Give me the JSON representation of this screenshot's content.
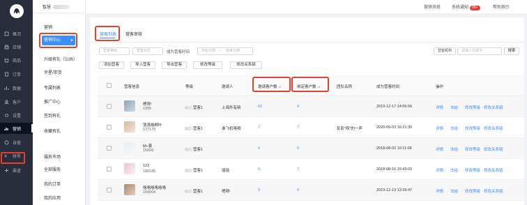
{
  "sidebar": {
    "items": [
      {
        "label": "概况",
        "icon": "home-icon"
      },
      {
        "label": "店铺",
        "icon": "shop-icon"
      },
      {
        "label": "商品",
        "icon": "goods-icon"
      },
      {
        "label": "订单",
        "icon": "order-icon"
      },
      {
        "label": "数据",
        "icon": "data-icon"
      },
      {
        "label": "客户",
        "icon": "user-icon"
      },
      {
        "label": "设置",
        "icon": "gear-icon"
      },
      {
        "label": "营销",
        "icon": "marketing-icon"
      },
      {
        "label": "自营",
        "icon": "self-icon"
      },
      {
        "label": "财务",
        "icon": "finance-icon"
      },
      {
        "label": "渠道",
        "icon": "channel-icon"
      }
    ],
    "active_index": 7
  },
  "subnav": {
    "brand": "智慧",
    "group1": "营销",
    "items": [
      "营销中心",
      "升级有礼（公共）",
      "评星/带货",
      "专属列表",
      "推广中心",
      "签到有礼",
      "收藏有礼"
    ],
    "group2": "服务市场",
    "items2": [
      "全部服务",
      "我的订单",
      "我的应用"
    ],
    "active_label": "营销中心"
  },
  "topbar": {
    "messages": "营销消息",
    "notice": "系统通知",
    "notice_badge": "99+",
    "help": "帮助指引"
  },
  "tabs": [
    {
      "label": "营客列表"
    },
    {
      "label": "营客审核"
    }
  ],
  "filters": {
    "level_placeholder": "营客等级",
    "status_placeholder": "营客状态",
    "date_label": "成为营客时间",
    "start_placeholder": "开始日期",
    "end_placeholder": "结束日期",
    "field_placeholder": "营客昵称",
    "keyword_placeholder": "请输入关键字",
    "search_label": "搜索"
  },
  "actions": [
    "添加营客",
    "导入营客",
    "导出营客",
    "修改等级",
    "修改关系链"
  ],
  "columns": [
    "营客信息",
    "等级",
    "邀请人",
    "邀请客户数",
    "绑定客户数",
    "团队名称",
    "成为营客时间",
    "操作"
  ],
  "rows": [
    {
      "name": "嗯呀!",
      "phone": "1355",
      "level": "营客1",
      "inviter": "上海外有新",
      "invite": "60",
      "bind": "0",
      "team": "",
      "time": "2019-12-17 14:06:56"
    },
    {
      "name": "落落格桐叶",
      "phone": "177175",
      "level": "营客1",
      "inviter": "谁飞机咯哦",
      "invite": "7",
      "bind": "7",
      "team": "彭彭\"呀\"的一声",
      "time": "2020-09-03 16:21:30"
    },
    {
      "name": "Mr.姜",
      "phone": "15006",
      "level": "营客1",
      "inviter": "",
      "invite": "6",
      "bind": "0",
      "team": "",
      "time": "2018-08-02 10:11:08"
    },
    {
      "name": "123",
      "phone": "180185",
      "level": "营客1",
      "inviter": "瑶瑶",
      "invite": "5",
      "bind": "7",
      "team": "",
      "time": "2018-08-16 15:43:03"
    },
    {
      "name": "咯咯咯咯咯咯",
      "phone": "159004",
      "level": "营客1",
      "inviter": "嗯呀!",
      "invite": "3",
      "bind": "0",
      "team": "",
      "time": "2019-12-13 13:39:47"
    }
  ],
  "row_actions": [
    "详情",
    "冻结",
    "修改等级",
    "修改关系链"
  ],
  "colors": {
    "accent": "#3d8eff",
    "highlight": "#e0432d",
    "sidebar": "#272d3a"
  }
}
